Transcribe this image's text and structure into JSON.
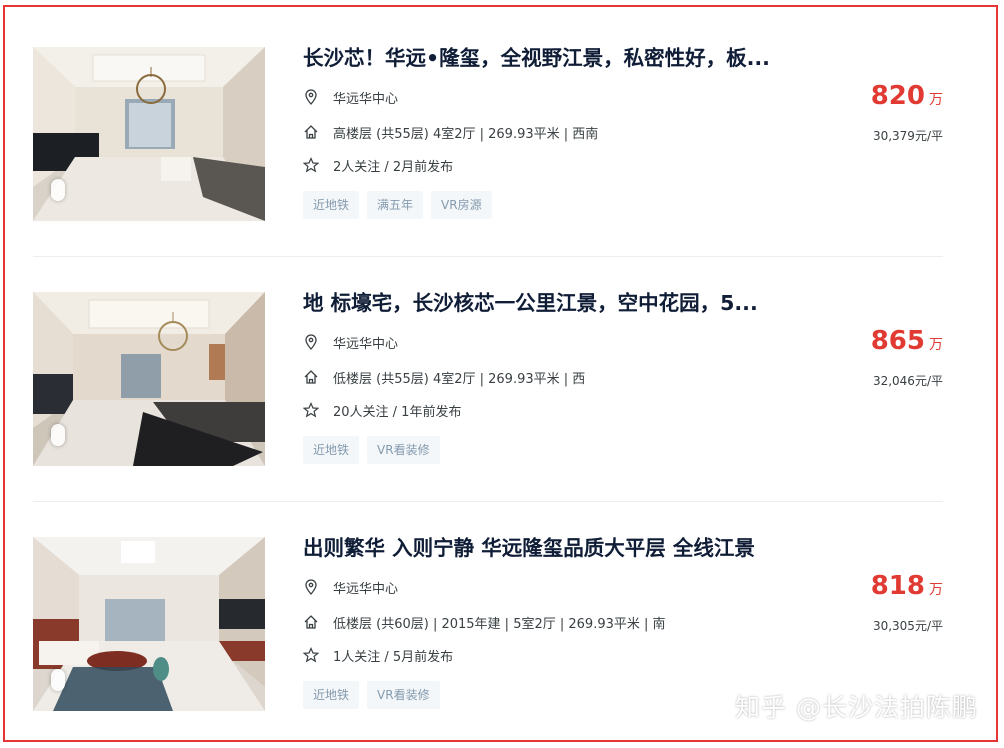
{
  "listings": [
    {
      "title": "长沙芯！华远•隆玺，全视野江景，私密性好，板...",
      "community": "华远华中心",
      "details": "高楼层 (共55层) 4室2厅 | 269.93平米 | 西南",
      "follow": "2人关注 / 2月前发布",
      "tags": [
        "近地铁",
        "满五年",
        "VR房源"
      ],
      "total_price": "820",
      "total_unit": "万",
      "unit_price": "30,379元/平"
    },
    {
      "title": "地 标壕宅，长沙核芯一公里江景，空中花园，5...",
      "community": "华远华中心",
      "details": "低楼层 (共55层) 4室2厅 | 269.93平米 | 西",
      "follow": "20人关注 / 1年前发布",
      "tags": [
        "近地铁",
        "VR看装修"
      ],
      "total_price": "865",
      "total_unit": "万",
      "unit_price": "32,046元/平"
    },
    {
      "title": "出则繁华 入则宁静 华远隆玺品质大平层 全线江景",
      "community": "华远华中心",
      "details": "低楼层 (共60层) | 2015年建 | 5室2厅 | 269.93平米 | 南",
      "follow": "1人关注 / 5月前发布",
      "tags": [
        "近地铁",
        "VR看装修"
      ],
      "total_price": "818",
      "total_unit": "万",
      "unit_price": "30,305元/平"
    }
  ],
  "icons": {
    "location": "location-pin-icon",
    "house": "house-icon",
    "follow": "star-icon"
  },
  "watermark": "知乎 @长沙法拍陈鹏",
  "colors": {
    "frame": "#e53535",
    "price": "#e03a32",
    "title": "#101d37",
    "tag_bg": "#f4f7f9",
    "tag_text": "#849aae"
  }
}
